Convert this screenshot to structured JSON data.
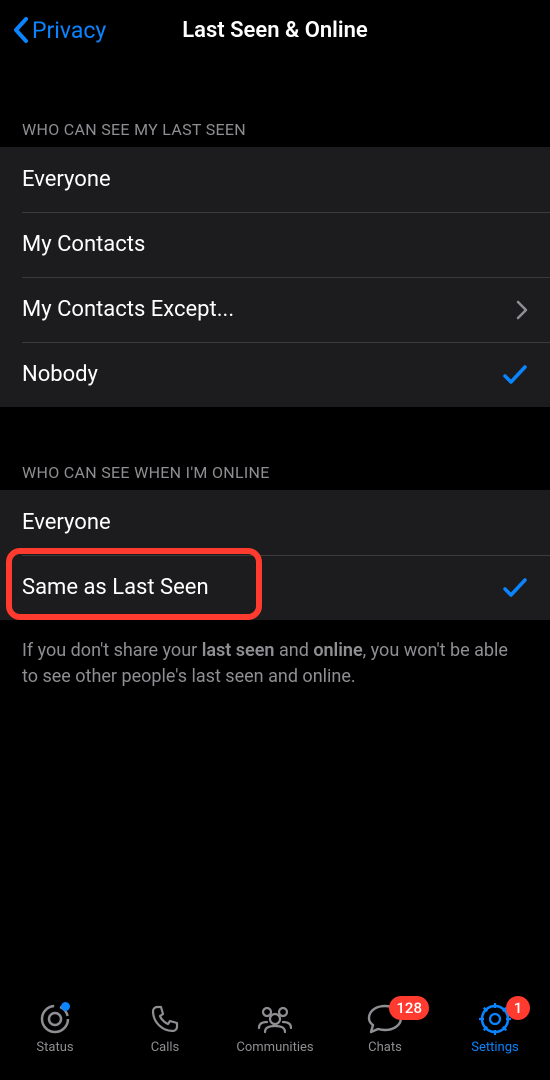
{
  "nav": {
    "back_label": "Privacy",
    "title": "Last Seen & Online"
  },
  "sections": {
    "last_seen": {
      "header": "WHO CAN SEE MY LAST SEEN",
      "options": [
        {
          "label": "Everyone"
        },
        {
          "label": "My Contacts"
        },
        {
          "label": "My Contacts Except..."
        },
        {
          "label": "Nobody"
        }
      ]
    },
    "online": {
      "header": "WHO CAN SEE WHEN I'M ONLINE",
      "options": [
        {
          "label": "Everyone"
        },
        {
          "label": "Same as Last Seen"
        }
      ],
      "footer_prefix": "If you don't share your ",
      "footer_b1": "last seen",
      "footer_mid": " and ",
      "footer_b2": "online",
      "footer_suffix": ", you won't be able to see other people's last seen and online."
    }
  },
  "tabs": {
    "status": "Status",
    "calls": "Calls",
    "communities": "Communities",
    "chats": "Chats",
    "settings": "Settings",
    "chats_badge": "128",
    "settings_badge": "1"
  }
}
